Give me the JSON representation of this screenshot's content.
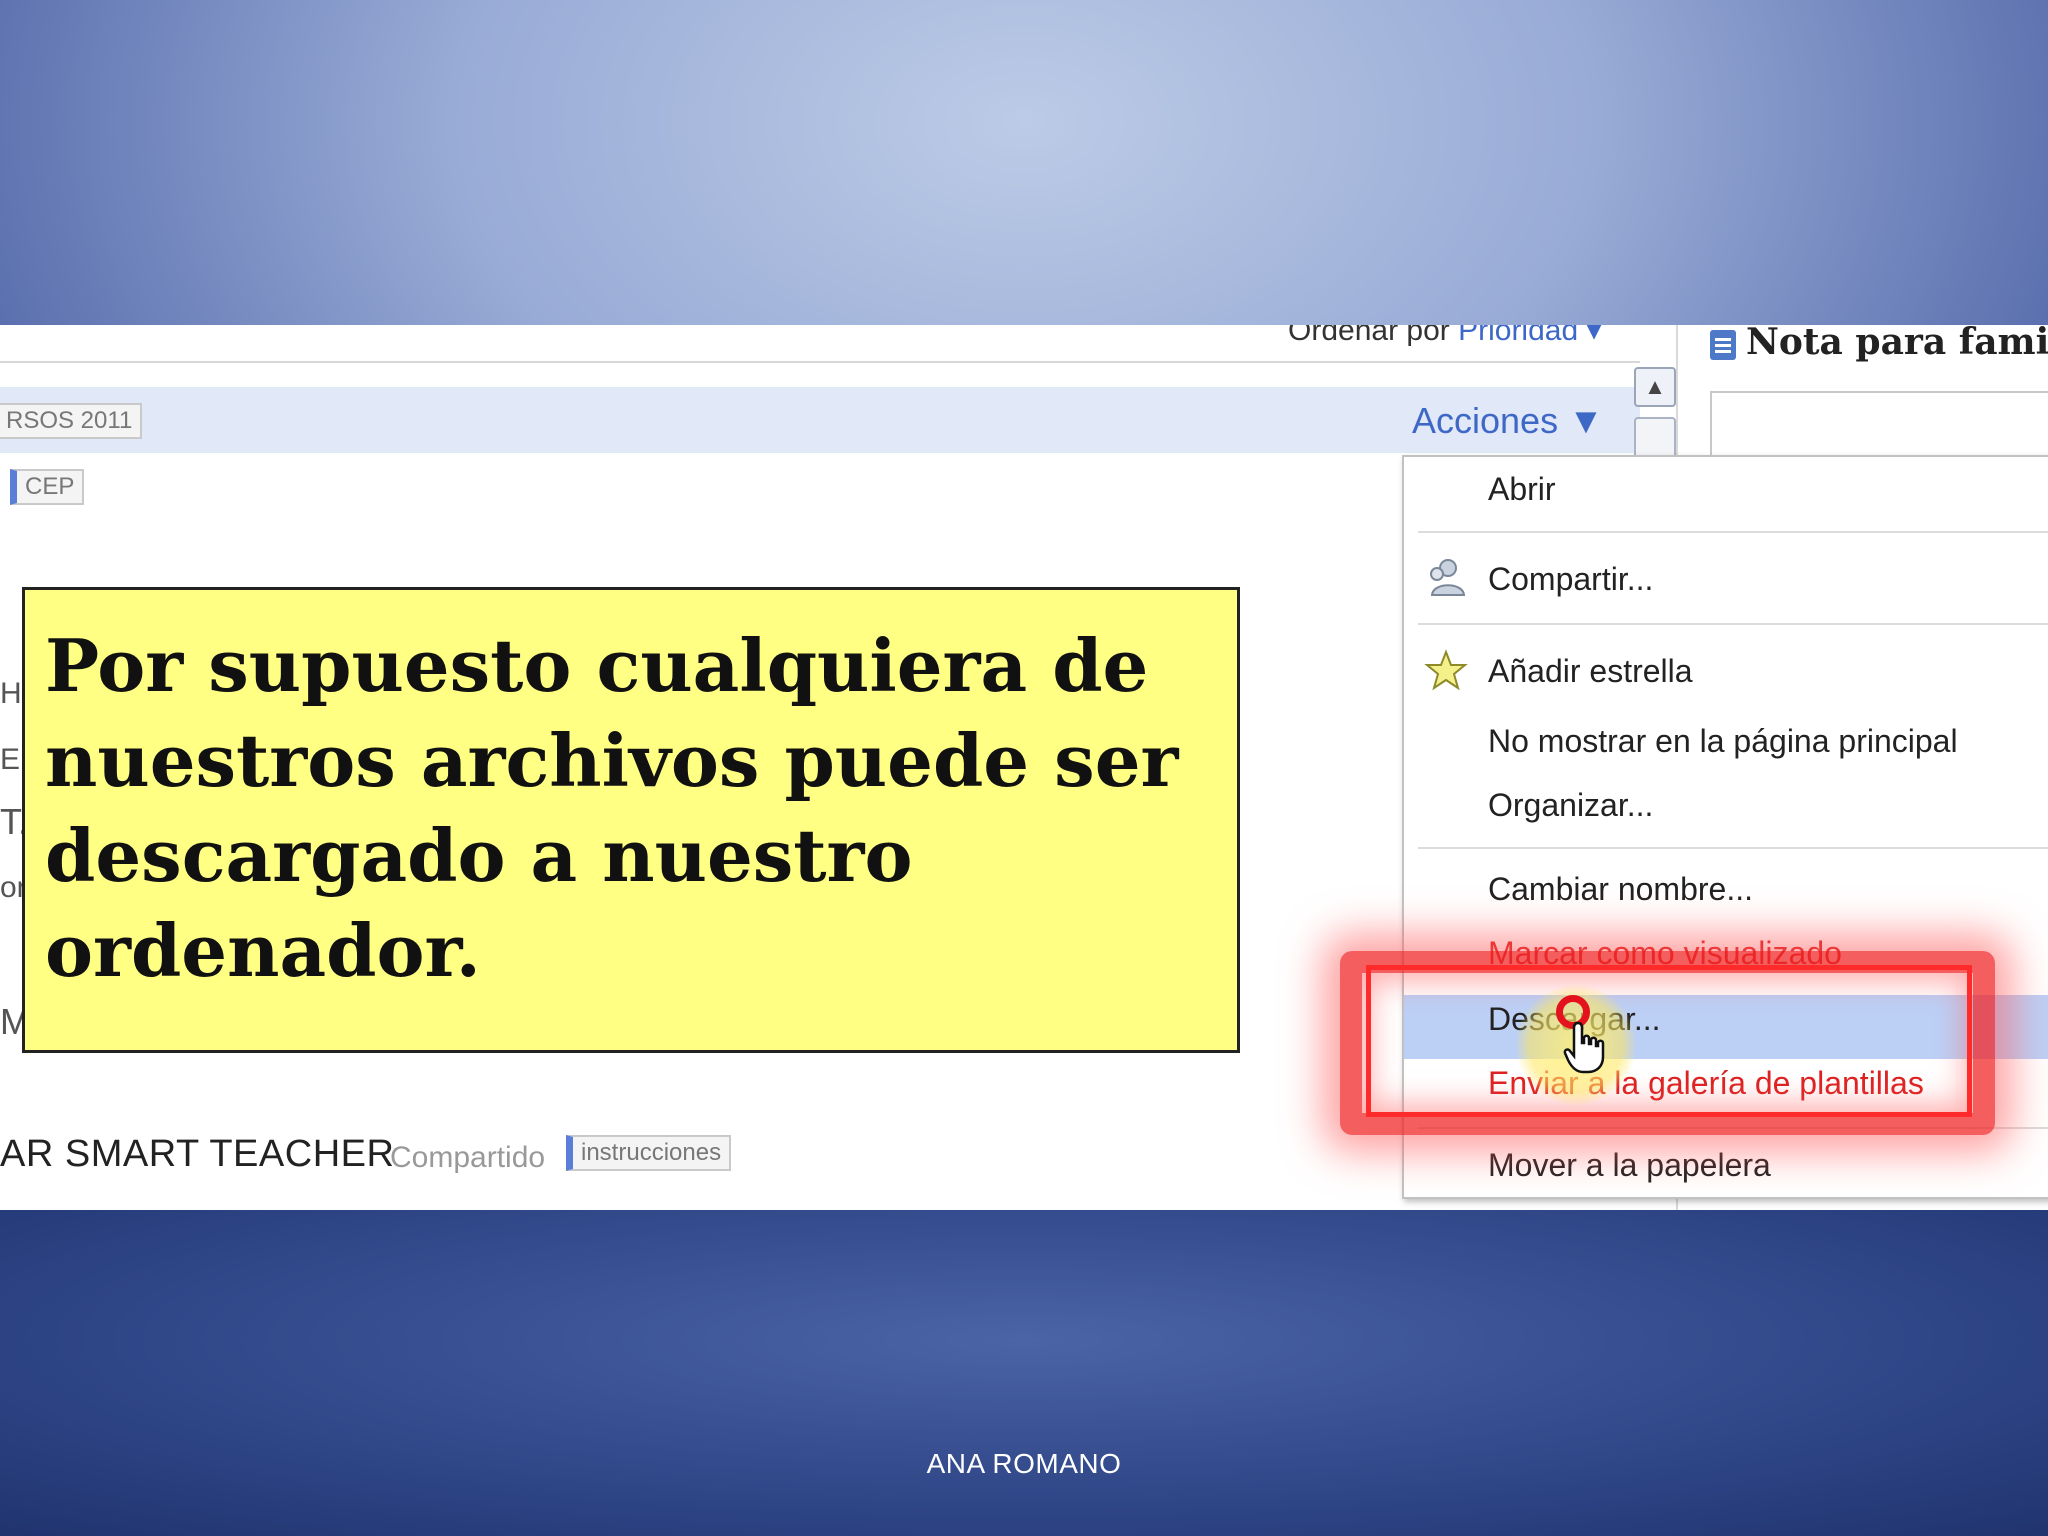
{
  "screenshot": {
    "sort": {
      "label": "Ordenar por",
      "value": "Prioridad ▾"
    },
    "note_title": "Nota para famili",
    "folder_tag": "RSOS 2011",
    "actions_label": "Acciones ▼",
    "cep_tag": "CEP",
    "left_fragments": [
      "Ho",
      "EF",
      "T.",
      "on",
      "M"
    ],
    "callout_text": "Por supuesto cualquiera de nuestros archivos puede ser descargado a nuestro ordenador.",
    "file_row": {
      "title": "AR SMART TEACHER",
      "shared": "Compartido",
      "tag": "instrucciones"
    },
    "menu": {
      "items": [
        {
          "label": "Abrir",
          "icon": "none"
        },
        {
          "label": "Compartir...",
          "icon": "share-people-icon"
        },
        {
          "label": "Añadir estrella",
          "icon": "star-icon"
        },
        {
          "label": "No mostrar en la página principal",
          "icon": "none"
        },
        {
          "label": "Organizar...",
          "icon": "none"
        },
        {
          "label": "Cambiar nombre...",
          "icon": "none"
        },
        {
          "label": "Marcar como visualizado",
          "icon": "none"
        },
        {
          "label": "Descargar...",
          "icon": "none",
          "highlighted": true
        },
        {
          "label": "Enviar a la galería de plantillas",
          "icon": "none"
        },
        {
          "label": "Mover a la papelera",
          "icon": "none"
        }
      ]
    },
    "colors": {
      "highlight": "#bcd0f6",
      "annotation": "#ff2a2a",
      "callout": "#ffff84",
      "link": "#3e68c6"
    }
  },
  "footer": {
    "author": "ANA ROMANO"
  }
}
